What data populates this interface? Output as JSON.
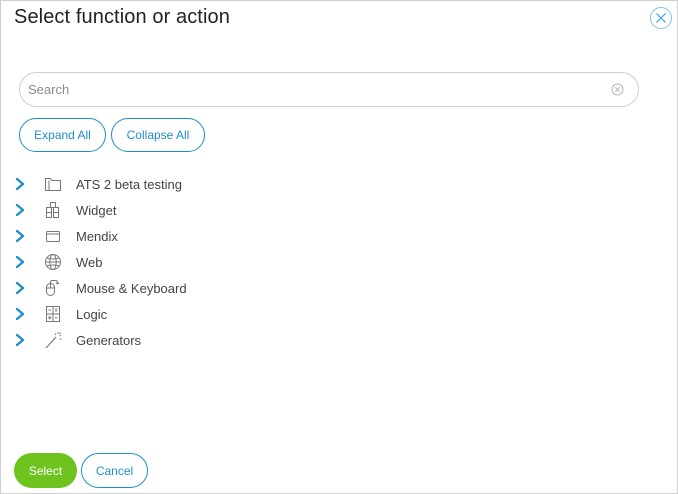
{
  "dialog": {
    "title": "Select function or action"
  },
  "search": {
    "placeholder": "Search",
    "value": ""
  },
  "toolbar": {
    "expand_all_label": "Expand All",
    "collapse_all_label": "Collapse All"
  },
  "tree": {
    "items": [
      {
        "label": "ATS 2 beta testing",
        "icon": "folder-icon"
      },
      {
        "label": "Widget",
        "icon": "widget-blocks-icon"
      },
      {
        "label": "Mendix",
        "icon": "window-icon"
      },
      {
        "label": "Web",
        "icon": "globe-icon"
      },
      {
        "label": "Mouse & Keyboard",
        "icon": "mouse-icon"
      },
      {
        "label": "Logic",
        "icon": "calculator-icon"
      },
      {
        "label": "Generators",
        "icon": "magic-wand-icon"
      }
    ]
  },
  "footer": {
    "select_label": "Select",
    "cancel_label": "Cancel"
  },
  "colors": {
    "accent": "#1f8fc8",
    "primary_button": "#6fc31f",
    "close_icon": "#7fc4e6"
  }
}
